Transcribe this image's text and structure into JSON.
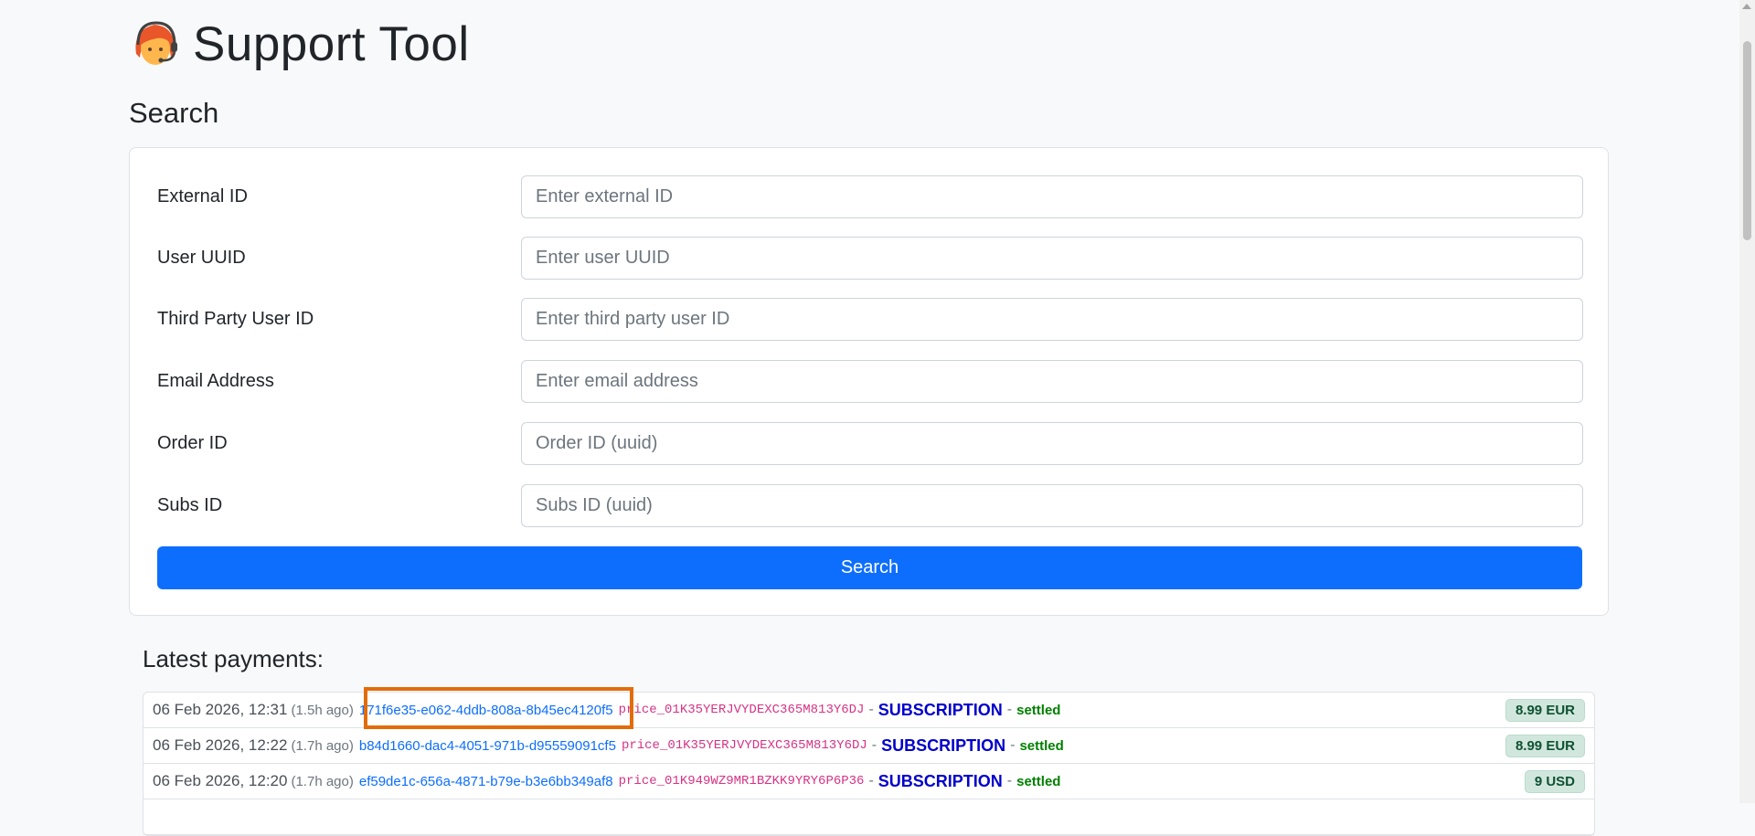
{
  "header": {
    "title": "Support Tool",
    "logo": "support-agent-icon"
  },
  "search": {
    "heading": "Search",
    "fields": [
      {
        "label": "External ID",
        "placeholder": "Enter external ID",
        "value": ""
      },
      {
        "label": "User UUID",
        "placeholder": "Enter user UUID",
        "value": ""
      },
      {
        "label": "Third Party User ID",
        "placeholder": "Enter third party user ID",
        "value": ""
      },
      {
        "label": "Email Address",
        "placeholder": "Enter email address",
        "value": ""
      },
      {
        "label": "Order ID",
        "placeholder": "Order ID (uuid)",
        "value": ""
      },
      {
        "label": "Subs ID",
        "placeholder": "Subs ID (uuid)",
        "value": ""
      }
    ],
    "button_label": "Search"
  },
  "payments": {
    "heading": "Latest payments:",
    "separator": "-",
    "rows": [
      {
        "date": "06 Feb 2026, 12:31",
        "ago": "(1.5h ago)",
        "uuid": "171f6e35-e062-4ddb-808a-8b45ec4120f5",
        "price_id": "price_01K35YERJVYDEXC365M813Y6DJ",
        "type": "SUBSCRIPTION",
        "status": "settled",
        "amount": "8.99 EUR"
      },
      {
        "date": "06 Feb 2026, 12:22",
        "ago": "(1.7h ago)",
        "uuid": "b84d1660-dac4-4051-971b-d95559091cf5",
        "price_id": "price_01K35YERJVYDEXC365M813Y6DJ",
        "type": "SUBSCRIPTION",
        "status": "settled",
        "amount": "8.99 EUR"
      },
      {
        "date": "06 Feb 2026, 12:20",
        "ago": "(1.7h ago)",
        "uuid": "ef59de1c-656a-4871-b79e-b3e6bb349af8",
        "price_id": "price_01K949WZ9MR1BZKK9YRY6P6P36",
        "type": "SUBSCRIPTION",
        "status": "settled",
        "amount": "9 USD"
      },
      {
        "date": "",
        "ago": "",
        "uuid": "",
        "price_id": "",
        "type": "",
        "status": "",
        "amount": ""
      }
    ]
  },
  "colors": {
    "primary": "#0d6efd",
    "highlight": "#e36c09",
    "type_text": "#0000cc",
    "status_text": "#008000"
  }
}
